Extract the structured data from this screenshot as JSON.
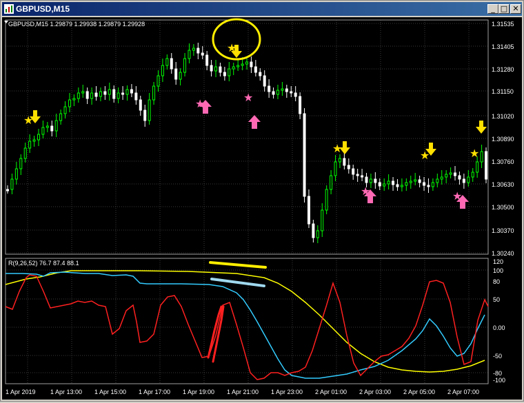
{
  "window": {
    "title": "GBPUSD,M15",
    "btn_minimize": "_",
    "btn_maximize": "□",
    "btn_close": "✕"
  },
  "price_pane": {
    "header": "GBPUSD,M15  1.29879 1.29938 1.29879 1.29928",
    "price_axis_labels": [
      "1.31535",
      "1.31405",
      "1.31280",
      "1.31150",
      "1.31020",
      "1.30890",
      "1.30760",
      "1.30630",
      "1.30500",
      "1.30370",
      "1.30240"
    ]
  },
  "indicator_pane": {
    "header": "R(9,26,52) 76.7 87.4 88.1",
    "axis_labels": [
      "120",
      "100",
      "80",
      "50",
      "0.00",
      "-50",
      "-80",
      "-100"
    ]
  },
  "time_axis_labels": [
    "1 Apr 2019",
    "1 Apr 13:00",
    "1 Apr 15:00",
    "1 Apr 17:00",
    "1 Apr 19:00",
    "1 Apr 21:00",
    "1 Apr 23:00",
    "2 Apr 01:00",
    "2 Apr 03:00",
    "2 Apr 05:00",
    "2 Apr 07:00"
  ],
  "colors": {
    "background": "#000000",
    "grid": "#3a3a3a",
    "bull_candle": "#00ff00",
    "bear_candle": "#ffffff",
    "signal_buy": "#ff69b4",
    "signal_sell": "#ffe000",
    "rsi_fast": "#ff2020",
    "rsi_mid": "#33ccff",
    "rsi_slow": "#ffff00",
    "annotation_yellow": "#ffee00",
    "annotation_blue": "#9fd8ee",
    "annotation_red": "#ff2020"
  }
}
